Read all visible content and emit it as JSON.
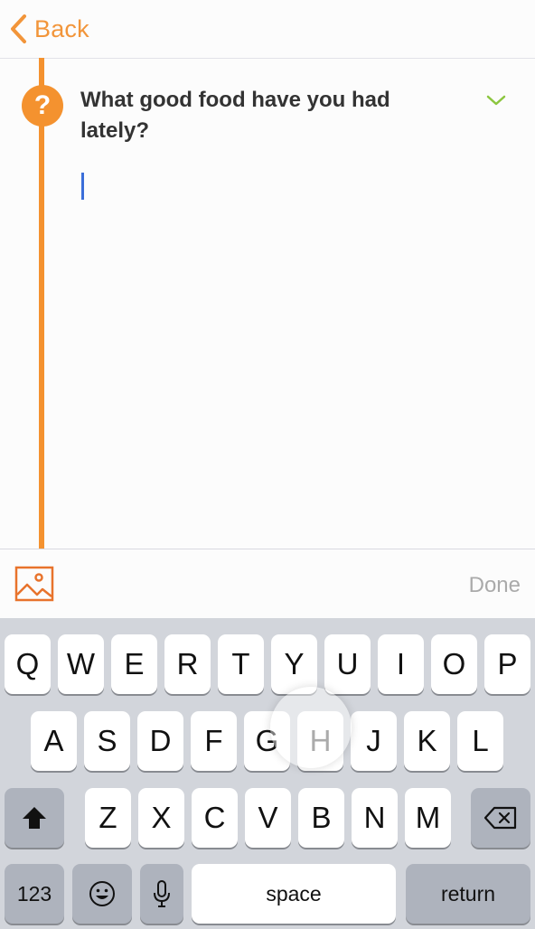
{
  "nav": {
    "back_label": "Back"
  },
  "entry": {
    "question_mark": "?",
    "question": "What good food have you had lately?",
    "answer": ""
  },
  "toolbar": {
    "done_label": "Done"
  },
  "keyboard": {
    "row1": [
      "Q",
      "W",
      "E",
      "R",
      "T",
      "Y",
      "U",
      "I",
      "O",
      "P"
    ],
    "row2": [
      "A",
      "S",
      "D",
      "F",
      "G",
      "H",
      "J",
      "K",
      "L"
    ],
    "row3": [
      "Z",
      "X",
      "C",
      "V",
      "B",
      "N",
      "M"
    ],
    "numbers_label": "123",
    "space_label": "space",
    "return_label": "return",
    "pressed_key": "H"
  },
  "colors": {
    "accent": "#f4922f",
    "chevron": "#8cc63f",
    "cursor": "#3b6ed9"
  }
}
